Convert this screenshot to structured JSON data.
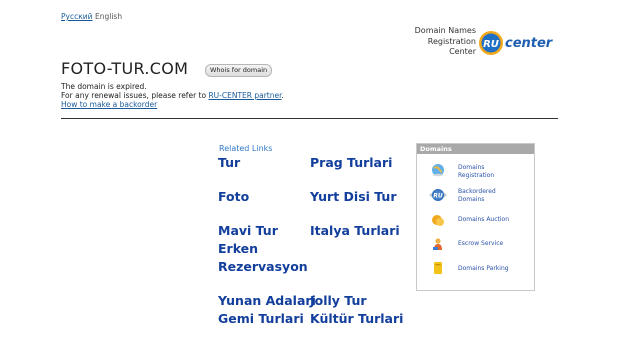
{
  "lang": {
    "ru": "Русский",
    "en": "English"
  },
  "brand": {
    "line1": "Domain Names",
    "line2": "Registration",
    "line3": "Center",
    "logo_ru": "RU",
    "logo_center": "center"
  },
  "domain": "FOTO-TUR.COM",
  "whois_label": "Whois for domain",
  "info": {
    "expired": "The domain is expired.",
    "renewal_prefix": "For any renewal issues, please refer to ",
    "renewal_link": "RU-CENTER partner",
    "renewal_suffix": ".",
    "backorder_link": "How to make a backorder"
  },
  "related": {
    "title": "Related Links",
    "left": [
      "Tur",
      "Foto",
      "Mavi Tur",
      "Erken",
      "Rezervasyon",
      "Yunan Adalari",
      "Gemi Turlari"
    ],
    "right": [
      "Prag Turlari",
      "Yurt Disi Tur",
      "Italya Turlari",
      "Jolly Tur",
      "Kültür Turlari"
    ]
  },
  "panel": {
    "title": "Domains",
    "items": [
      {
        "line1": "Domains",
        "line2": "Registration",
        "icon": "globe-icon"
      },
      {
        "line1": "Backordered",
        "line2": "Domains",
        "icon": "ru-badge-icon"
      },
      {
        "line1": "Domains Auction",
        "line2": "",
        "icon": "auction-coins-icon"
      },
      {
        "line1": "Escrow Service",
        "line2": "",
        "icon": "escrow-person-icon"
      },
      {
        "line1": "Domains Parking",
        "line2": "",
        "icon": "parking-icon"
      }
    ]
  },
  "colors": {
    "link": "#123e9c",
    "accent": "#2f79c8",
    "panel_header": "#a9a9a9"
  }
}
